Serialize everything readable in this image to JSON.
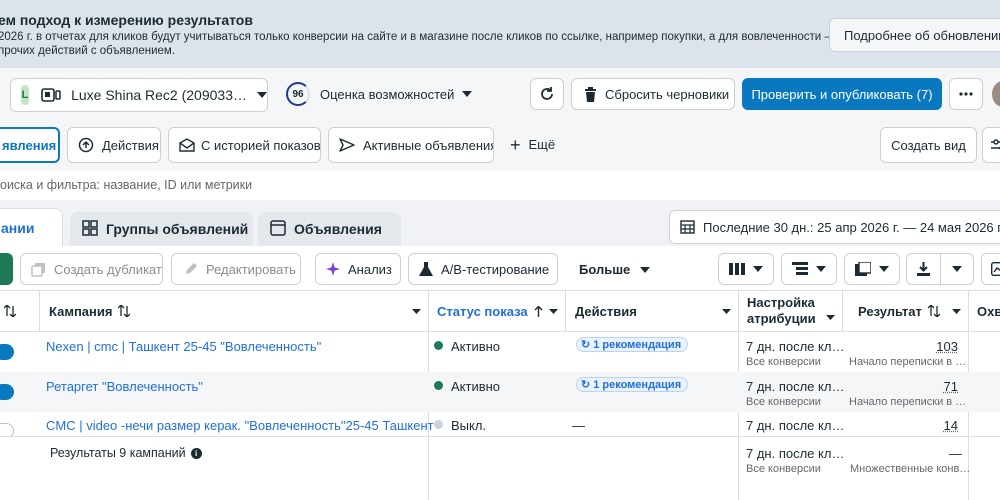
{
  "banner": {
    "title": "ем подход к измерению результатов",
    "line1": " 2026 г. в отчетах для кликов будут учитываться только конверсии на сайте и в магазине после кликов по ссылке, например покупки, а для вовлеченности — конверсии",
    "line2": "прочих действий с объявлением.",
    "button": "Подробнее об обновлении"
  },
  "account": {
    "badge": "L",
    "name": "Luxe Shina Rec2 (209033…",
    "score": "96",
    "score_label": "Оценка возможностей"
  },
  "header": {
    "discard": "Сбросить черновики",
    "publish": "Проверить и опубликовать (7)"
  },
  "views": {
    "current": "явления",
    "actions": "Действия",
    "history": "С историей показов",
    "active": "Активные объявления",
    "more": "Ещё",
    "create_view": "Создать вид"
  },
  "search": {
    "placeholder": "оиска и фильтра: название, ID или метрики"
  },
  "tabs": {
    "campaigns": "ании",
    "adsets": "Группы объявлений",
    "ads": "Объявления",
    "date_range": "Последние 30 дн.: 25 апр 2026 г. — 24 мая 2026 г."
  },
  "toolbar": {
    "duplicate": "Создать дубликат",
    "edit": "Редактировать",
    "analysis": "Анализ",
    "ab_test": "A/B-тестирование",
    "more": "Больше"
  },
  "table": {
    "columns": {
      "campaign": "Кампания",
      "status": "Статус показа",
      "actions": "Действия",
      "attribution_1": "Настройка",
      "attribution_2": "атрибуции",
      "result": "Результат",
      "reach": "Охв"
    },
    "rows": [
      {
        "name": "Nexen | cmc | Ташкент 25-45 \"Вовлеченность\"",
        "status": "Активно",
        "status_color": "#1e7a55",
        "action": "1 рекомендация",
        "attr": "7 дн. после кл…",
        "attr_sub": "Все конверсии",
        "result": "103",
        "result_sub": "Начало переписки в …"
      },
      {
        "name": "Ретаргет \"Вовлеченность\"",
        "status": "Активно",
        "status_color": "#1e7a55",
        "action": "1 рекомендация",
        "attr": "7 дн. после кл…",
        "attr_sub": "Все конверсии",
        "result": "71",
        "result_sub": "Начало переписки в …"
      },
      {
        "name": "CMC | video -нечи размер керак. \"Вовлеченность\"25-45 Ташкент",
        "status": "Выкл.",
        "status_color": "#cbd2d9",
        "action": "—",
        "attr": "7 дн. после кл…",
        "attr_sub": "",
        "result": "14",
        "result_sub": ""
      }
    ],
    "footer": {
      "label": "Результаты 9 кампаний",
      "attr": "7 дн. после кл…",
      "attr_sub": "Все конверсии",
      "result": "—",
      "result_sub": "Множественные конв…"
    }
  },
  "colors": {
    "primary": "#0a78be",
    "link": "#216fdb",
    "active": "#1e7a55",
    "off": "#cbd2d9"
  }
}
